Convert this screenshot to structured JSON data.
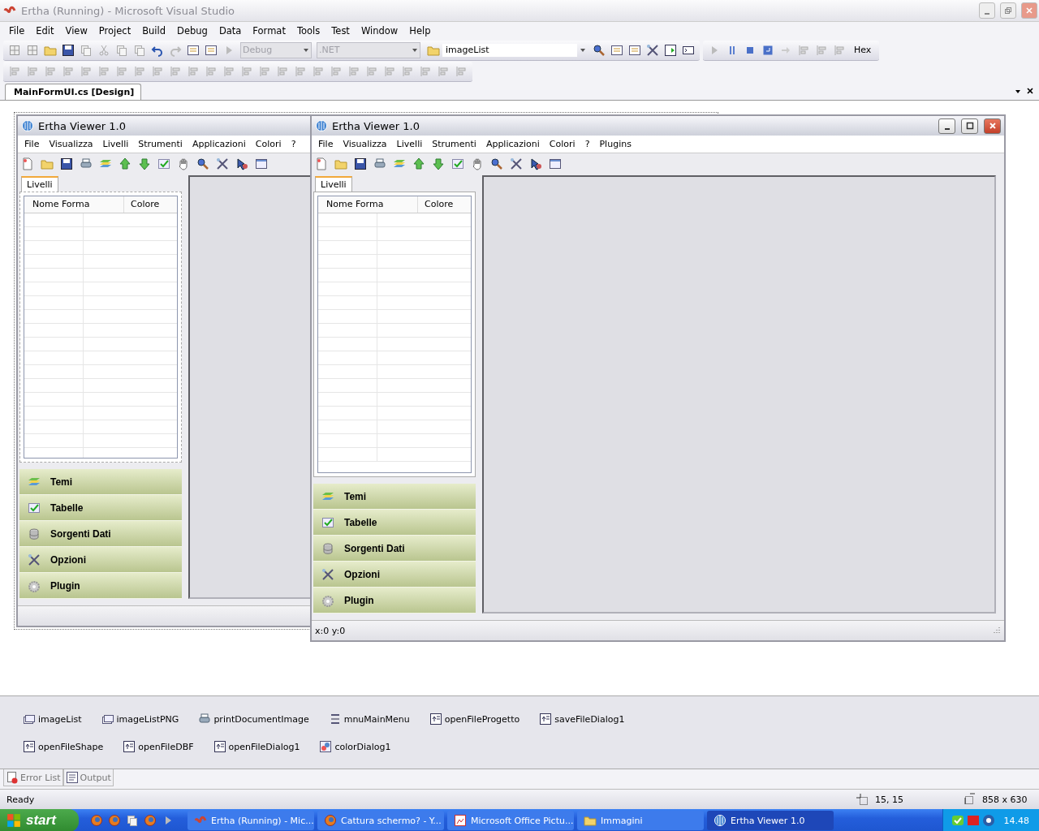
{
  "ide": {
    "title": "Ertha (Running) - Microsoft Visual Studio",
    "menu": [
      "File",
      "Edit",
      "View",
      "Project",
      "Build",
      "Debug",
      "Data",
      "Format",
      "Tools",
      "Test",
      "Window",
      "Help"
    ],
    "toolbar": {
      "combos": [
        {
          "value": "Debug",
          "disabled": true
        },
        {
          "value": ".NET",
          "disabled": true
        },
        {
          "value": "imageList",
          "disabled": false
        }
      ],
      "hex": "Hex"
    },
    "document_tab": "MainFormUI.cs [Design]"
  },
  "forms": [
    {
      "kind": "designer",
      "title": "Ertha Viewer 1.0",
      "menu": [
        "File",
        "Visualizza",
        "Livelli",
        "Strumenti",
        "Applicazioni",
        "Colori",
        "?"
      ],
      "tab": "Livelli",
      "columns": [
        "Nome Forma",
        "Colore"
      ],
      "sections": [
        {
          "kind": "layers",
          "label": "Temi"
        },
        {
          "kind": "table",
          "label": "Tabelle"
        },
        {
          "kind": "database",
          "label": "Sorgenti Dati"
        },
        {
          "kind": "tools",
          "label": "Opzioni"
        },
        {
          "kind": "gear",
          "label": "Plugin"
        }
      ]
    },
    {
      "kind": "running",
      "title": "Ertha Viewer 1.0",
      "menu": [
        "File",
        "Visualizza",
        "Livelli",
        "Strumenti",
        "Applicazioni",
        "Colori",
        "?",
        "Plugins"
      ],
      "tab": "Livelli",
      "columns": [
        "Nome Forma",
        "Colore"
      ],
      "sections": [
        {
          "kind": "layers",
          "label": "Temi"
        },
        {
          "kind": "table",
          "label": "Tabelle"
        },
        {
          "kind": "database",
          "label": "Sorgenti Dati"
        },
        {
          "kind": "tools",
          "label": "Opzioni"
        },
        {
          "kind": "gear",
          "label": "Plugin"
        }
      ],
      "status": "x:0 y:0"
    }
  ],
  "components": [
    {
      "kind": "imagelist",
      "name": "imageList"
    },
    {
      "kind": "imagelist",
      "name": "imageListPNG"
    },
    {
      "kind": "print",
      "name": "printDocumentImage"
    },
    {
      "kind": "menu",
      "name": "mnuMainMenu"
    },
    {
      "kind": "dialog",
      "name": "openFileProgetto"
    },
    {
      "kind": "dialog",
      "name": "saveFileDialog1"
    },
    {
      "kind": "dialog",
      "name": "openFileShape"
    },
    {
      "kind": "dialog",
      "name": "openFileDBF"
    },
    {
      "kind": "dialog",
      "name": "openFileDialog1"
    },
    {
      "kind": "color",
      "name": "colorDialog1"
    }
  ],
  "tool_tabs": [
    {
      "kind": "errors",
      "label": "Error List"
    },
    {
      "kind": "output",
      "label": "Output"
    }
  ],
  "status_bar": {
    "text": "Ready",
    "position": "15, 15",
    "size": "858 x 630"
  },
  "taskbar": {
    "start": "start",
    "items": [
      {
        "kind": "vs",
        "label": "Ertha (Running) - Mic...",
        "selected": false
      },
      {
        "kind": "browser",
        "label": "Cattura schermo? - Y...",
        "selected": false
      },
      {
        "kind": "picture",
        "label": "Microsoft Office Pictu...",
        "selected": false
      },
      {
        "kind": "folder",
        "label": "Immagini",
        "selected": false
      },
      {
        "kind": "app",
        "label": "Ertha Viewer 1.0",
        "selected": true
      }
    ],
    "clock": "14.48"
  }
}
